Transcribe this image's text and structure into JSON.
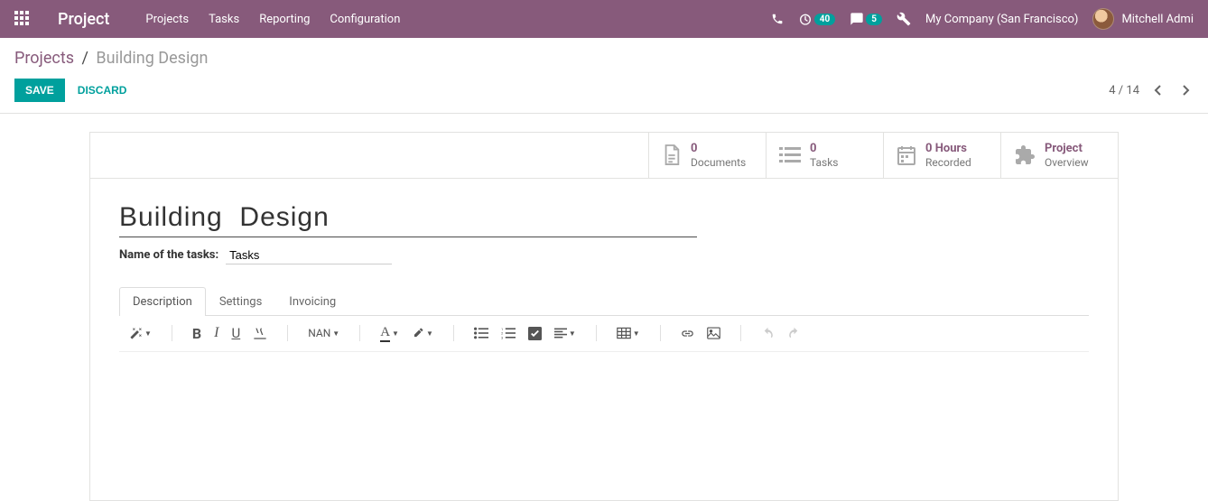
{
  "navbar": {
    "brand": "Project",
    "menu": [
      "Projects",
      "Tasks",
      "Reporting",
      "Configuration"
    ],
    "timer_badge": "40",
    "chat_badge": "5",
    "company": "My Company (San Francisco)",
    "user": "Mitchell Admi"
  },
  "breadcrumb": {
    "root": "Projects",
    "current": "Building Design"
  },
  "actions": {
    "save": "SAVE",
    "discard": "DISCARD",
    "pager": "4 / 14"
  },
  "stats": {
    "documents": {
      "value": "0",
      "label": "Documents"
    },
    "tasks": {
      "value": "0",
      "label": "Tasks"
    },
    "hours": {
      "value": "0 Hours",
      "label": "Recorded"
    },
    "overview": {
      "value": "Project",
      "label": "Overview"
    }
  },
  "form": {
    "title": "Building  Design",
    "tasks_label": "Name of the tasks:",
    "tasks_value": "Tasks"
  },
  "tabs": {
    "description": "Description",
    "settings": "Settings",
    "invoicing": "Invoicing"
  },
  "toolbar": {
    "size_label": "NAN"
  }
}
